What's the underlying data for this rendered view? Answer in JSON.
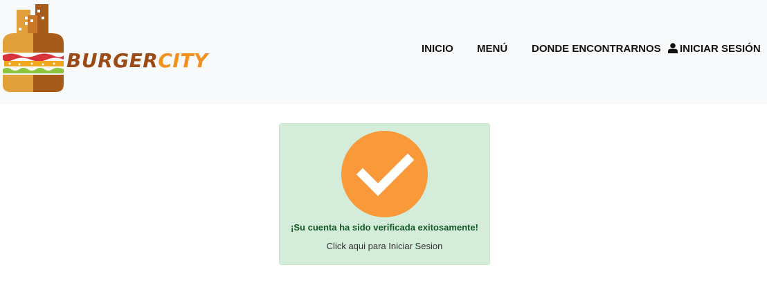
{
  "brand": {
    "name_part1": "BURGER",
    "name_part2": "CITY",
    "colors": {
      "part1": "#9b4b17",
      "part2": "#f4901e"
    }
  },
  "nav": {
    "items": [
      {
        "label": "INICIO"
      },
      {
        "label": "MENÚ"
      },
      {
        "label": "DONDE ENCONTRARNOS"
      },
      {
        "label": "INICIAR SESIÓN",
        "icon": "user-icon"
      }
    ]
  },
  "verification": {
    "icon": "check-icon",
    "message": "¡Su cuenta ha sido verificada exitosamente!",
    "link_text": "Click aqui para Iniciar Sesion",
    "colors": {
      "card_bg": "#d4edda",
      "circle": "#f9993a",
      "message": "#155724"
    }
  }
}
